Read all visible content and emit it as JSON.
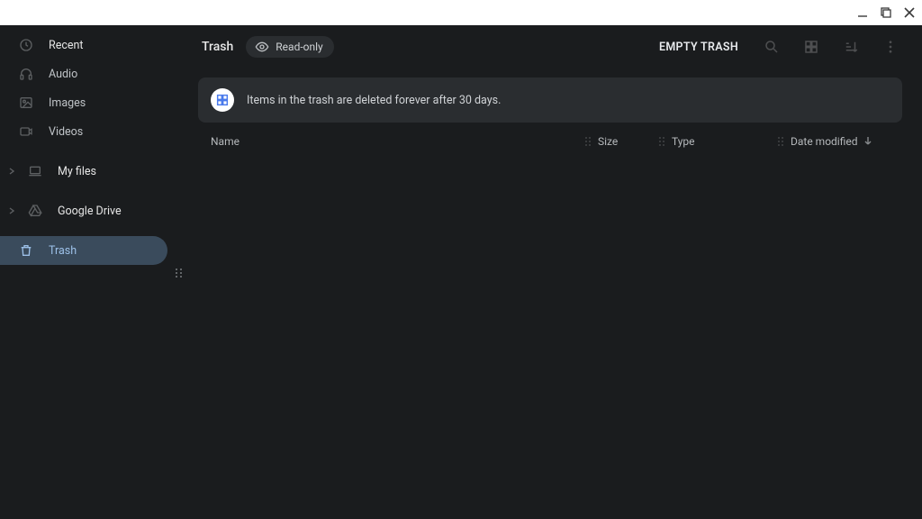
{
  "sidebar": {
    "items": [
      {
        "label": "Recent",
        "icon": "clock"
      },
      {
        "label": "Audio",
        "icon": "headphones"
      },
      {
        "label": "Images",
        "icon": "image"
      },
      {
        "label": "Videos",
        "icon": "video"
      }
    ],
    "groups": [
      {
        "label": "My files",
        "icon": "laptop"
      },
      {
        "label": "Google Drive",
        "icon": "drive"
      }
    ],
    "trash": {
      "label": "Trash",
      "icon": "trash"
    }
  },
  "header": {
    "title": "Trash",
    "chip_label": "Read-only",
    "empty_label": "EMPTY TRASH"
  },
  "banner": {
    "text": "Items in the trash are deleted forever after 30 days."
  },
  "columns": {
    "name": "Name",
    "size": "Size",
    "type": "Type",
    "date": "Date modified"
  }
}
